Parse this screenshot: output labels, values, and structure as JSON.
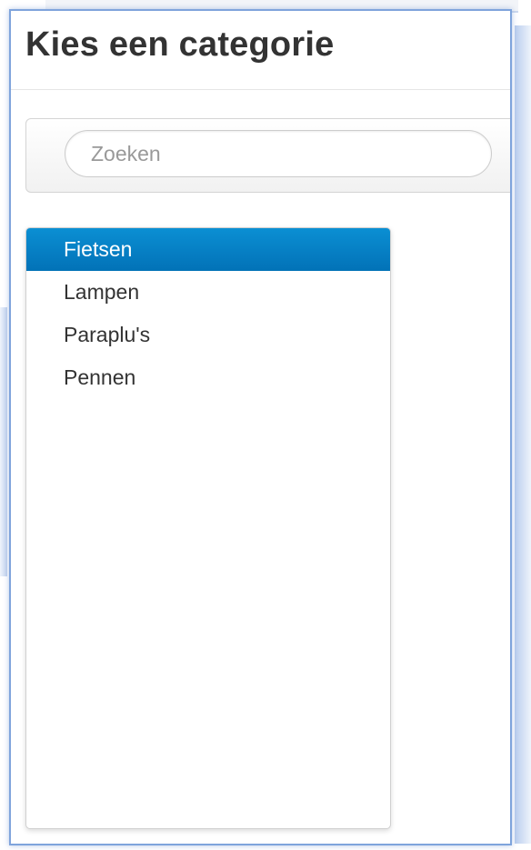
{
  "dialog": {
    "title": "Kies een categorie"
  },
  "search": {
    "placeholder": "Zoeken",
    "value": ""
  },
  "categories": {
    "selected": "Fietsen",
    "items": [
      {
        "label": "Fietsen"
      },
      {
        "label": "Lampen"
      },
      {
        "label": "Paraplu's"
      },
      {
        "label": "Pennen"
      }
    ]
  },
  "colors": {
    "accent": "#0a84c8",
    "dialog_border": "#7fa4dc",
    "title_text": "#333333"
  }
}
